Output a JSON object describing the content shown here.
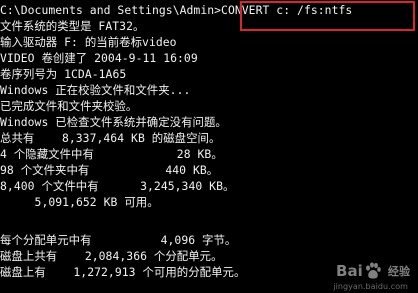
{
  "console": {
    "lines": [
      "C:\\Documents and Settings\\Admin>CONVERT c: /fs:ntfs",
      "文件系统的类型是 FAT32。",
      "输入驱动器 F: 的当前卷标video",
      "VIDEO 卷创建了 2004-9-11 16:09",
      "卷序列号为 1CDA-1A65",
      "Windows 正在校验文件和文件夹...",
      "已完成文件和文件夹校验。",
      "Windows 已检查文件系统并确定没有问题。",
      "总共有    8,337,464 KB 的磁盘空间。",
      "4 个隐藏文件中有            28 KB。",
      "98 个文件夹中有           440 KB。",
      "8,400 个文件中有      3,245,340 KB。",
      "     5,091,652 KB 可用。",
      "",
      "每个分配单元中有          4,096 字节。",
      "磁盘上共有    2,084,366 个分配单元。",
      "磁盘上有    1,272,913 个可用的分配单元。"
    ],
    "text_color": "#f2f2f2",
    "background": "#000000"
  },
  "highlight": {
    "color": "#d8262d",
    "target_text": "CONVERT c: /fs:ntfs"
  },
  "watermark": {
    "brand": "Bai",
    "brand_suffix": "经验",
    "url": "jingyan.baidu.com"
  }
}
